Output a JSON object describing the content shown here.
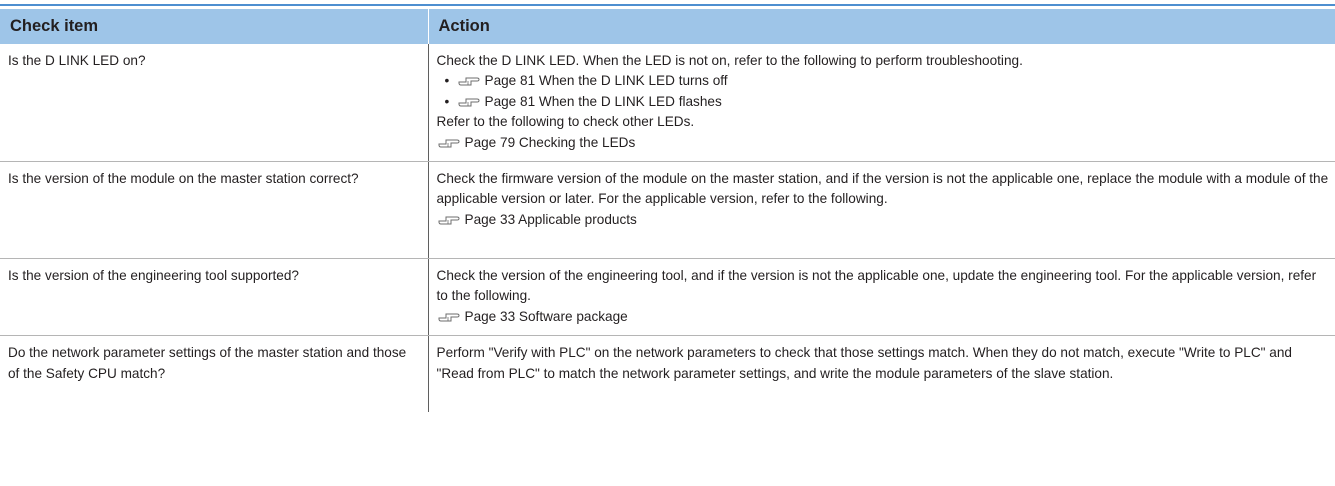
{
  "table": {
    "headers": [
      "Check item",
      "Action"
    ],
    "rows": [
      {
        "check": "Is the D LINK LED on?",
        "action": {
          "intro": "Check the D LINK LED. When the LED is not on, refer to the following to perform troubleshooting.",
          "bullets": [
            "Page 81 When the D LINK LED turns off",
            "Page 81 When the D LINK LED flashes"
          ],
          "text2": "Refer to the following to check other LEDs.",
          "ref": "Page 79 Checking the LEDs"
        }
      },
      {
        "check": "Is the version of the module on the master station correct?",
        "action": {
          "intro": "Check the firmware version of the module on the master station, and if the version is not the applicable one, replace the module with a module of the applicable version or later. For the applicable version, refer to the following.",
          "ref": "Page 33 Applicable products"
        }
      },
      {
        "check": "Is the version of the engineering tool supported?",
        "action": {
          "intro": "Check the version of the engineering tool, and if the version is not the applicable one, update the engineering tool. For the applicable version, refer to the following.",
          "ref": "Page 33 Software package"
        }
      },
      {
        "check": "Do the network parameter settings of the master station and those of the Safety CPU match?",
        "action": {
          "intro": "Perform \"Verify with PLC\" on the network parameters to check that those settings match. When they do not match, execute \"Write to PLC\" and \"Read from PLC\" to match the network parameter settings, and write the module parameters of the slave station."
        }
      }
    ]
  },
  "icons": {
    "reference": "pointing-hand-reference-icon",
    "bullet": "•"
  },
  "colors": {
    "header_bg": "#9ec5e8",
    "top_rule": "#4e8fd0",
    "row_rule": "#b5b5b5"
  }
}
